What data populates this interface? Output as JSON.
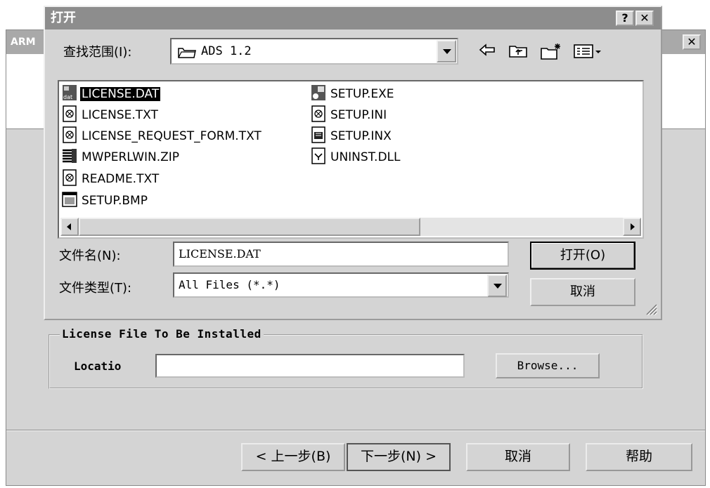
{
  "background_window": {
    "title": "ARM",
    "close_label": "✕",
    "header_text": "",
    "license_group_title": "License File To Be Installed",
    "location_label": "Locatio",
    "location_value": "",
    "browse_label": "Browse...",
    "buttons": {
      "back": "< 上一步(B)",
      "next": "下一步(N) >",
      "cancel": "取消",
      "help": "帮助"
    }
  },
  "open_dialog": {
    "title": "打开",
    "help_btn": "?",
    "close_btn": "✕",
    "look_in_label": "查找范围(I):",
    "look_in_value": "ADS 1.2",
    "toolbar_icons": [
      "back-arrow-icon",
      "up-folder-icon",
      "new-folder-icon",
      "view-menu-icon"
    ],
    "files": [
      {
        "name": "LICENSE.DAT",
        "icon": "dat-file-icon",
        "selected": true
      },
      {
        "name": "LICENSE.TXT",
        "icon": "text-file-icon",
        "selected": false
      },
      {
        "name": "LICENSE_REQUEST_FORM.TXT",
        "icon": "text-file-icon",
        "selected": false
      },
      {
        "name": "MWPERLWIN.ZIP",
        "icon": "zip-file-icon",
        "selected": false
      },
      {
        "name": "README.TXT",
        "icon": "text-file-icon",
        "selected": false
      },
      {
        "name": "SETUP.BMP",
        "icon": "bitmap-file-icon",
        "selected": false
      },
      {
        "name": "SETUP.EXE",
        "icon": "setup-exe-icon",
        "selected": false
      },
      {
        "name": "SETUP.INI",
        "icon": "ini-file-icon",
        "selected": false
      },
      {
        "name": "SETUP.INX",
        "icon": "inx-file-icon",
        "selected": false
      },
      {
        "name": "UNINST.DLL",
        "icon": "dll-file-icon",
        "selected": false
      }
    ],
    "file_name_label": "文件名(N):",
    "file_name_value": "LICENSE.DAT",
    "file_type_label": "文件类型(T):",
    "file_type_value": "All Files (*.*)",
    "open_label": "打开(O)",
    "cancel_label": "取消"
  }
}
